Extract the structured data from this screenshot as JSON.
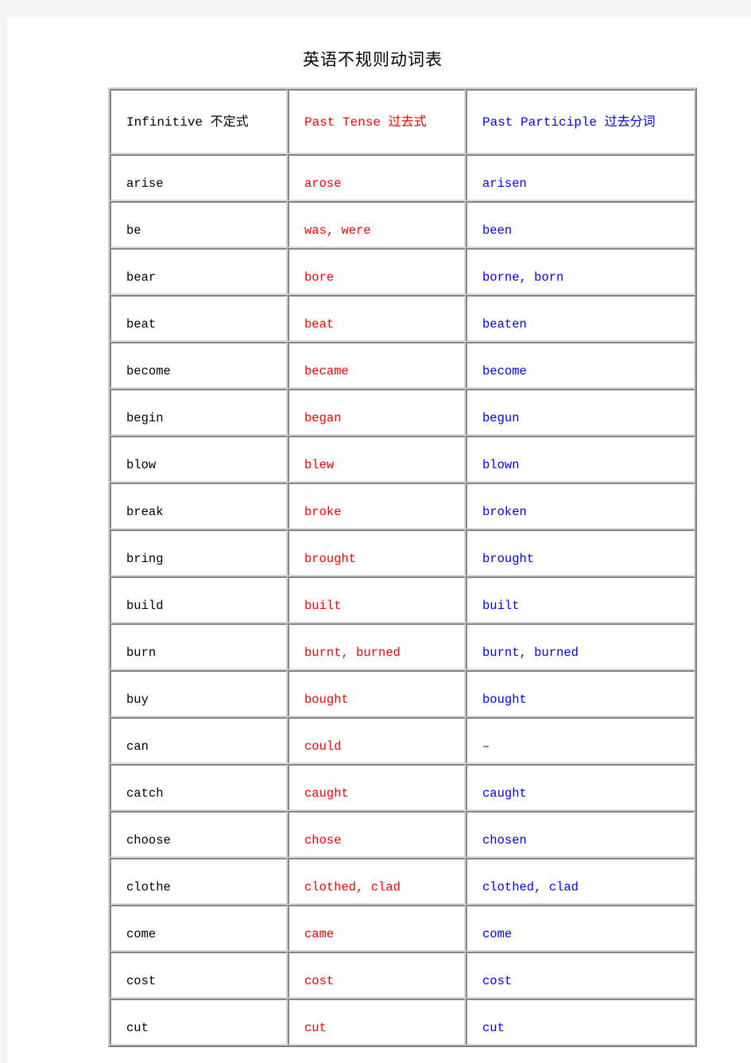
{
  "document": {
    "title": "英语不规则动词表",
    "background_color": "#f4f4f4",
    "page_color": "#ffffff"
  },
  "table": {
    "columns": [
      {
        "key": "infinitive",
        "label": "Infinitive 不定式",
        "color": "#000000"
      },
      {
        "key": "past",
        "label": "Past Tense 过去式",
        "color": "#ff0000"
      },
      {
        "key": "participle",
        "label": "Past Participle 过去分词",
        "color": "#0000ff"
      }
    ],
    "rows": [
      {
        "infinitive": "arise",
        "past": "arose",
        "participle": "arisen"
      },
      {
        "infinitive": "be",
        "past": "was, were",
        "participle": "been"
      },
      {
        "infinitive": "bear",
        "past": "bore",
        "participle": "borne, born"
      },
      {
        "infinitive": "beat",
        "past": "beat",
        "participle": "beaten"
      },
      {
        "infinitive": "become",
        "past": "became",
        "participle": "become"
      },
      {
        "infinitive": "begin",
        "past": "began",
        "participle": "begun"
      },
      {
        "infinitive": "blow",
        "past": "blew",
        "participle": "blown"
      },
      {
        "infinitive": "break",
        "past": "broke",
        "participle": "broken"
      },
      {
        "infinitive": "bring",
        "past": "brought",
        "participle": "brought"
      },
      {
        "infinitive": "build",
        "past": "built",
        "participle": "built"
      },
      {
        "infinitive": "burn",
        "past": "burnt, burned",
        "participle": "burnt, burned"
      },
      {
        "infinitive": "buy",
        "past": "bought",
        "participle": "bought"
      },
      {
        "infinitive": "can",
        "past": "could",
        "participle": "–"
      },
      {
        "infinitive": "catch",
        "past": "caught",
        "participle": "caught"
      },
      {
        "infinitive": "choose",
        "past": "chose",
        "participle": "chosen"
      },
      {
        "infinitive": "clothe",
        "past": "clothed, clad",
        "participle": "clothed, clad"
      },
      {
        "infinitive": "come",
        "past": "came",
        "participle": "come"
      },
      {
        "infinitive": "cost",
        "past": "cost",
        "participle": "cost"
      },
      {
        "infinitive": "cut",
        "past": "cut",
        "participle": "cut"
      }
    ]
  }
}
